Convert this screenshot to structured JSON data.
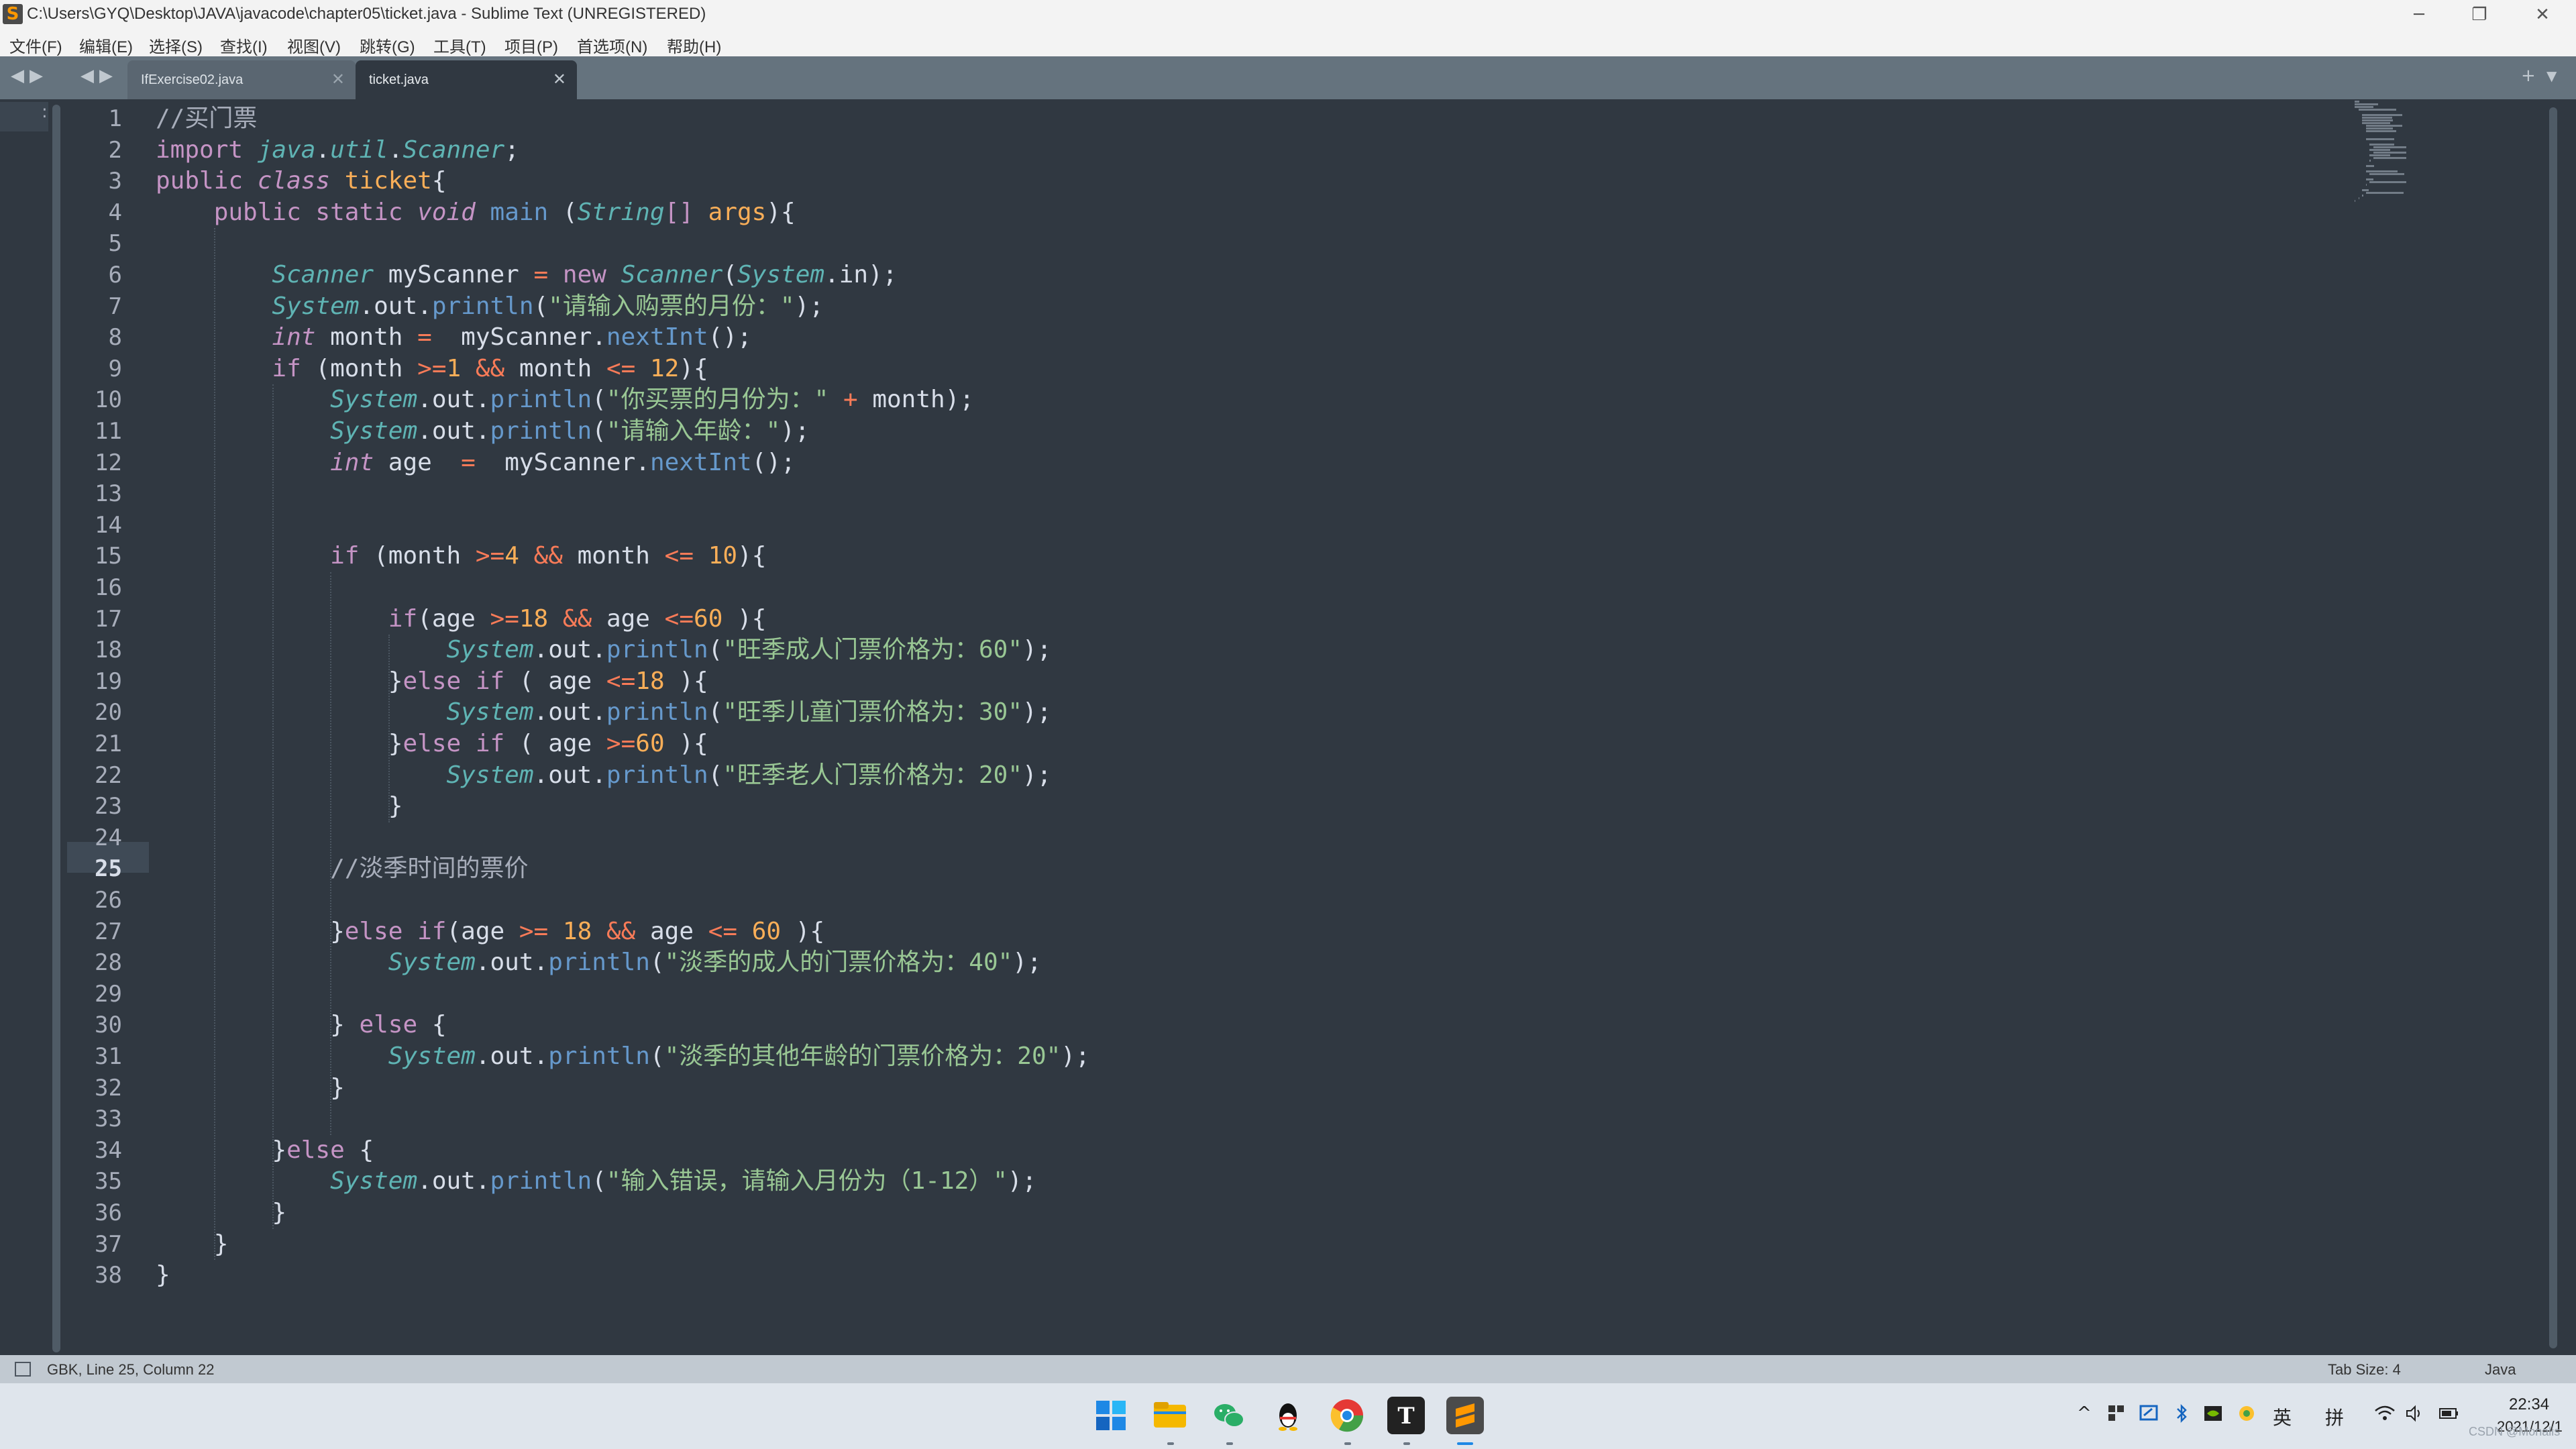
{
  "window": {
    "title": "C:\\Users\\GYQ\\Desktop\\JAVA\\javacode\\chapter05\\ticket.java - Sublime Text (UNREGISTERED)",
    "minimize": "─",
    "maximize": "❐",
    "close": "✕"
  },
  "menu": [
    "文件(F)",
    "编辑(E)",
    "选择(S)",
    "查找(I)",
    "视图(V)",
    "跳转(G)",
    "工具(T)",
    "项目(P)",
    "首选项(N)",
    "帮助(H)"
  ],
  "tabs": [
    {
      "label": "IfExercise02.java",
      "active": false
    },
    {
      "label": "ticket.java",
      "active": true
    }
  ],
  "tab_close_glyph": "✕",
  "nav": {
    "left": "◀",
    "right": "▶",
    "plus": "+",
    "down": "▼"
  },
  "editor": {
    "current_line": 25,
    "line_numbers": [
      "1",
      "2",
      "3",
      "4",
      "5",
      "6",
      "7",
      "8",
      "9",
      "10",
      "11",
      "12",
      "13",
      "14",
      "15",
      "16",
      "17",
      "18",
      "19",
      "20",
      "21",
      "22",
      "23",
      "24",
      "25",
      "26",
      "27",
      "28",
      "29",
      "30",
      "31",
      "32",
      "33",
      "34",
      "35",
      "36",
      "37",
      "38"
    ],
    "tokens": [
      [
        {
          "t": "//买门票",
          "c": "c"
        }
      ],
      [
        {
          "t": "import ",
          "c": "k"
        },
        {
          "t": "java",
          "c": "cl"
        },
        {
          "t": "."
        },
        {
          "t": "util",
          "c": "cl"
        },
        {
          "t": "."
        },
        {
          "t": "Scanner",
          "c": "cl"
        },
        {
          "t": ";"
        }
      ],
      [
        {
          "t": "public ",
          "c": "k"
        },
        {
          "t": "class ",
          "c": "t"
        },
        {
          "t": "ticket",
          "c": "cn"
        },
        {
          "t": "{"
        }
      ],
      [
        {
          "t": "    "
        },
        {
          "t": "public ",
          "c": "k"
        },
        {
          "t": "static ",
          "c": "k"
        },
        {
          "t": "void ",
          "c": "t"
        },
        {
          "t": "main",
          "c": "f"
        },
        {
          "t": " ("
        },
        {
          "t": "String",
          "c": "cl"
        },
        {
          "t": "[] ",
          "c": "k"
        },
        {
          "t": "args",
          "c": "cn"
        },
        {
          "t": "){"
        }
      ],
      [],
      [
        {
          "t": "        "
        },
        {
          "t": "Scanner",
          "c": "cl"
        },
        {
          "t": " myScanner "
        },
        {
          "t": "=",
          "c": "o"
        },
        {
          "t": " "
        },
        {
          "t": "new ",
          "c": "k"
        },
        {
          "t": "Scanner",
          "c": "cl"
        },
        {
          "t": "("
        },
        {
          "t": "System",
          "c": "cl"
        },
        {
          "t": ".in);"
        }
      ],
      [
        {
          "t": "        "
        },
        {
          "t": "System",
          "c": "cl"
        },
        {
          "t": ".out."
        },
        {
          "t": "println",
          "c": "f"
        },
        {
          "t": "("
        },
        {
          "t": "\"请输入购票的月份：\"",
          "c": "s"
        },
        {
          "t": ");"
        }
      ],
      [
        {
          "t": "        "
        },
        {
          "t": "int",
          "c": "t"
        },
        {
          "t": " month "
        },
        {
          "t": "=",
          "c": "o"
        },
        {
          "t": "  myScanner."
        },
        {
          "t": "nextInt",
          "c": "f"
        },
        {
          "t": "();"
        }
      ],
      [
        {
          "t": "        "
        },
        {
          "t": "if",
          "c": "k"
        },
        {
          "t": " (month "
        },
        {
          "t": ">=",
          "c": "o"
        },
        {
          "t": "1",
          "c": "n"
        },
        {
          "t": " "
        },
        {
          "t": "&&",
          "c": "o"
        },
        {
          "t": " month "
        },
        {
          "t": "<=",
          "c": "o"
        },
        {
          "t": " "
        },
        {
          "t": "12",
          "c": "n"
        },
        {
          "t": "){"
        }
      ],
      [
        {
          "t": "            "
        },
        {
          "t": "System",
          "c": "cl"
        },
        {
          "t": ".out."
        },
        {
          "t": "println",
          "c": "f"
        },
        {
          "t": "("
        },
        {
          "t": "\"你买票的月份为：\"",
          "c": "s"
        },
        {
          "t": " "
        },
        {
          "t": "+",
          "c": "o"
        },
        {
          "t": " month);"
        }
      ],
      [
        {
          "t": "            "
        },
        {
          "t": "System",
          "c": "cl"
        },
        {
          "t": ".out."
        },
        {
          "t": "println",
          "c": "f"
        },
        {
          "t": "("
        },
        {
          "t": "\"请输入年龄：\"",
          "c": "s"
        },
        {
          "t": ");"
        }
      ],
      [
        {
          "t": "            "
        },
        {
          "t": "int",
          "c": "t"
        },
        {
          "t": " age  "
        },
        {
          "t": "=",
          "c": "o"
        },
        {
          "t": "  myScanner."
        },
        {
          "t": "nextInt",
          "c": "f"
        },
        {
          "t": "();"
        }
      ],
      [],
      [],
      [
        {
          "t": "            "
        },
        {
          "t": "if",
          "c": "k"
        },
        {
          "t": " (month "
        },
        {
          "t": ">=",
          "c": "o"
        },
        {
          "t": "4",
          "c": "n"
        },
        {
          "t": " "
        },
        {
          "t": "&&",
          "c": "o"
        },
        {
          "t": " month "
        },
        {
          "t": "<=",
          "c": "o"
        },
        {
          "t": " "
        },
        {
          "t": "10",
          "c": "n"
        },
        {
          "t": "){"
        }
      ],
      [],
      [
        {
          "t": "                "
        },
        {
          "t": "if",
          "c": "k"
        },
        {
          "t": "(age "
        },
        {
          "t": ">=",
          "c": "o"
        },
        {
          "t": "18",
          "c": "n"
        },
        {
          "t": " "
        },
        {
          "t": "&&",
          "c": "o"
        },
        {
          "t": " age "
        },
        {
          "t": "<=",
          "c": "o"
        },
        {
          "t": "60",
          "c": "n"
        },
        {
          "t": " ){"
        }
      ],
      [
        {
          "t": "                    "
        },
        {
          "t": "System",
          "c": "cl"
        },
        {
          "t": ".out."
        },
        {
          "t": "println",
          "c": "f"
        },
        {
          "t": "("
        },
        {
          "t": "\"旺季成人门票价格为：60\"",
          "c": "s"
        },
        {
          "t": ");"
        }
      ],
      [
        {
          "t": "                }"
        },
        {
          "t": "else if",
          "c": "k"
        },
        {
          "t": " ( age "
        },
        {
          "t": "<=",
          "c": "o"
        },
        {
          "t": "18",
          "c": "n"
        },
        {
          "t": " ){"
        }
      ],
      [
        {
          "t": "                    "
        },
        {
          "t": "System",
          "c": "cl"
        },
        {
          "t": ".out."
        },
        {
          "t": "println",
          "c": "f"
        },
        {
          "t": "("
        },
        {
          "t": "\"旺季儿童门票价格为：30\"",
          "c": "s"
        },
        {
          "t": ");"
        }
      ],
      [
        {
          "t": "                }"
        },
        {
          "t": "else if",
          "c": "k"
        },
        {
          "t": " ( age "
        },
        {
          "t": ">=",
          "c": "o"
        },
        {
          "t": "60",
          "c": "n"
        },
        {
          "t": " ){"
        }
      ],
      [
        {
          "t": "                    "
        },
        {
          "t": "System",
          "c": "cl"
        },
        {
          "t": ".out."
        },
        {
          "t": "println",
          "c": "f"
        },
        {
          "t": "("
        },
        {
          "t": "\"旺季老人门票价格为：20\"",
          "c": "s"
        },
        {
          "t": ");"
        }
      ],
      [
        {
          "t": "                }"
        }
      ],
      [],
      [
        {
          "t": "            "
        },
        {
          "t": "//淡季时间的票价",
          "c": "c"
        }
      ],
      [],
      [
        {
          "t": "            }"
        },
        {
          "t": "else if",
          "c": "k"
        },
        {
          "t": "(age "
        },
        {
          "t": ">=",
          "c": "o"
        },
        {
          "t": " "
        },
        {
          "t": "18",
          "c": "n"
        },
        {
          "t": " "
        },
        {
          "t": "&&",
          "c": "o"
        },
        {
          "t": " age "
        },
        {
          "t": "<=",
          "c": "o"
        },
        {
          "t": " "
        },
        {
          "t": "60",
          "c": "n"
        },
        {
          "t": " ){"
        }
      ],
      [
        {
          "t": "                "
        },
        {
          "t": "System",
          "c": "cl"
        },
        {
          "t": ".out."
        },
        {
          "t": "println",
          "c": "f"
        },
        {
          "t": "("
        },
        {
          "t": "\"淡季的成人的门票价格为：40\"",
          "c": "s"
        },
        {
          "t": ");"
        }
      ],
      [],
      [
        {
          "t": "            } "
        },
        {
          "t": "else",
          "c": "k"
        },
        {
          "t": " {"
        }
      ],
      [
        {
          "t": "                "
        },
        {
          "t": "System",
          "c": "cl"
        },
        {
          "t": ".out."
        },
        {
          "t": "println",
          "c": "f"
        },
        {
          "t": "("
        },
        {
          "t": "\"淡季的其他年龄的门票价格为：20\"",
          "c": "s"
        },
        {
          "t": ");"
        }
      ],
      [
        {
          "t": "            }"
        }
      ],
      [],
      [
        {
          "t": "        }"
        },
        {
          "t": "else",
          "c": "k"
        },
        {
          "t": " {"
        }
      ],
      [
        {
          "t": "            "
        },
        {
          "t": "System",
          "c": "cl"
        },
        {
          "t": ".out."
        },
        {
          "t": "println",
          "c": "f"
        },
        {
          "t": "("
        },
        {
          "t": "\"输入错误，请输入月份为（1-12）\"",
          "c": "s"
        },
        {
          "t": ");"
        }
      ],
      [
        {
          "t": "        }"
        }
      ],
      [
        {
          "t": "    }"
        }
      ],
      [
        {
          "t": "}"
        }
      ]
    ]
  },
  "status": {
    "position": "GBK, Line 25, Column 22",
    "tab_size": "Tab Size: 4",
    "syntax": "Java"
  },
  "taskbar": {
    "icons": [
      "windows-start-icon",
      "file-explorer-icon",
      "wechat-icon",
      "qq-icon",
      "chrome-icon",
      "typora-icon",
      "sublime-text-icon"
    ],
    "colors": {
      "start": "#1e88e5",
      "explorer": "#f5b800",
      "wechat": "#2aae67",
      "qq": "#111111",
      "chrome": "#e53935",
      "typora": "#222222",
      "sublime": "#ff9800"
    },
    "tray": {
      "chevron": "^",
      "ime_lang": "英",
      "ime_mode": "拼",
      "wifi": "wifi-icon",
      "volume": "volume-icon",
      "battery": "battery-icon"
    },
    "time": "22:34",
    "date": "2021/12/1"
  },
  "watermark": "CSDN @Monalis"
}
